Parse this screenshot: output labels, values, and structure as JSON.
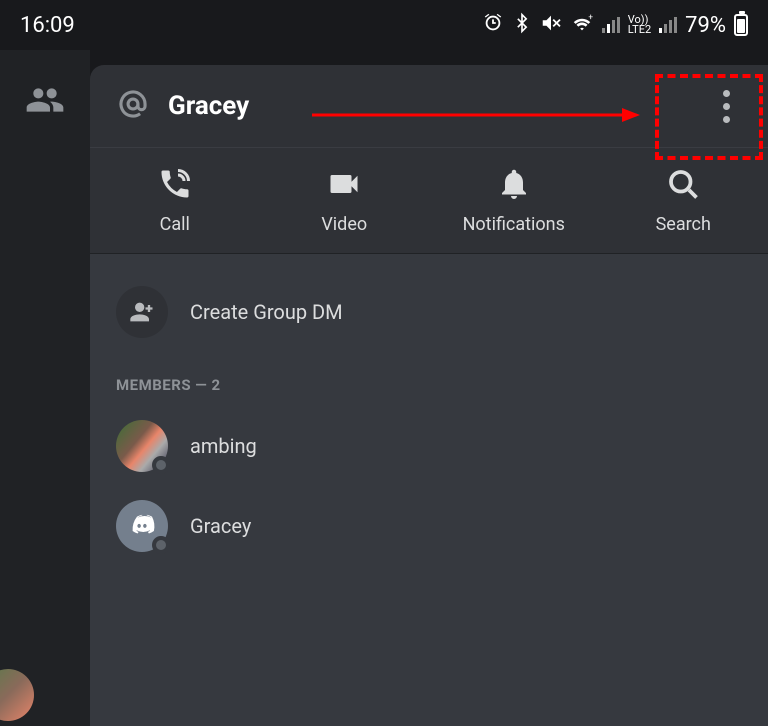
{
  "statusbar": {
    "time": "16:09",
    "battery_percent": "79%",
    "network_label": "Vo))\nLTE2"
  },
  "header": {
    "title": "Gracey"
  },
  "actions": {
    "call": "Call",
    "video": "Video",
    "notifications": "Notifications",
    "search": "Search"
  },
  "create_group_label": "Create Group DM",
  "members_header": "MEMBERS — 2",
  "members": [
    {
      "name": "ambing"
    },
    {
      "name": "Gracey"
    }
  ]
}
